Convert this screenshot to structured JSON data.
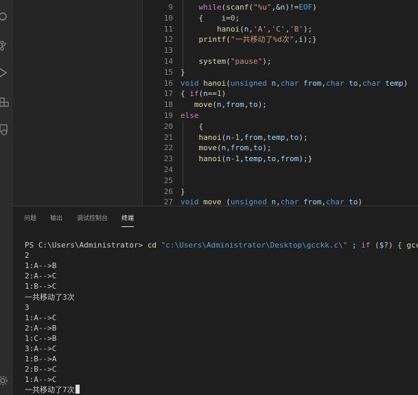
{
  "activity_bar": {
    "icons": [
      "search-icon",
      "source-control-icon",
      "run-debug-icon",
      "extensions-icon",
      "remote-explorer-icon",
      "settings-gear-icon"
    ]
  },
  "editor": {
    "lines": [
      {
        "num": "9",
        "text": "    while(scanf(\"%u\",&n)!=EOF)"
      },
      {
        "num": "10",
        "text": "    {    i=0;"
      },
      {
        "num": "11",
        "text": "        hanoi(n,'A','C','B');"
      },
      {
        "num": "12",
        "text": "    printf(\"一共移动了%d次\",i);}"
      },
      {
        "num": "13",
        "text": ""
      },
      {
        "num": "14",
        "text": "    system(\"pause\");"
      },
      {
        "num": "15",
        "text": "}"
      },
      {
        "num": "16",
        "text": "void hanoi(unsigned n,char from,char to,char temp)"
      },
      {
        "num": "17",
        "text": "{ if(n==1)"
      },
      {
        "num": "18",
        "text": "   move(n,from,to);"
      },
      {
        "num": "19",
        "text": "else"
      },
      {
        "num": "20",
        "text": "    {"
      },
      {
        "num": "21",
        "text": "    hanoi(n-1,from,temp,to);"
      },
      {
        "num": "22",
        "text": "    move(n,from,to);"
      },
      {
        "num": "23",
        "text": "    hanoi(n-1,temp,to,from);}"
      },
      {
        "num": "24",
        "text": ""
      },
      {
        "num": "25",
        "text": ""
      },
      {
        "num": "26",
        "text": "}"
      },
      {
        "num": "27",
        "text": "void move (unsigned n,char from,char to)"
      }
    ]
  },
  "panel": {
    "tabs": [
      "问题",
      "输出",
      "调试控制台",
      "终端"
    ],
    "active_tab": "终端"
  },
  "terminal": {
    "lines": [
      "PS C:\\Users\\Administrator> cd \"c:\\Users\\Administrator\\Desktop\\gcckk.c\\\" ; if ($?) { gcc diqizhou",
      "2",
      "1:A-->B",
      "2:A-->C",
      "1:B-->C",
      "一共移动了3次",
      "3",
      "1:A-->C",
      "2:A-->B",
      "1:C-->B",
      "3:A-->C",
      "1:B-->A",
      "2:B-->C",
      "1:A-->C",
      "一共移动了7次"
    ]
  },
  "colors": {
    "keyword": "#569cd6",
    "control": "#c586c0",
    "string": "#ce9178",
    "number": "#b5cea8",
    "function": "#dcdcaa",
    "variable": "#9cdcfe",
    "text": "#d4d4d4"
  }
}
